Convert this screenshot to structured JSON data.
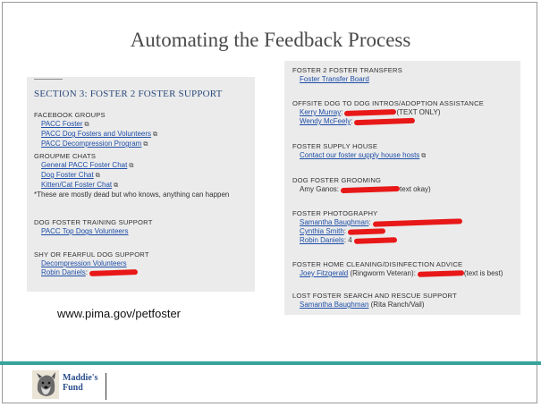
{
  "title": "Automating the Feedback Process",
  "left_panel": {
    "section_heading": "SECTION 3: FOSTER 2 FOSTER SUPPORT",
    "groups": [
      {
        "title": "FACEBOOK GROUPS",
        "items": [
          "PACC Foster",
          "PACC Dog Fosters and Volunteers",
          "PACC Decompression Program"
        ]
      },
      {
        "title": "GROUPME CHATS",
        "items": [
          "General PACC Foster Chat",
          "Dog Foster Chat",
          "Kitten/Cat Foster Chat"
        ],
        "note": "*These are mostly dead but who knows, anything can happen"
      },
      {
        "title": "DOG FOSTER TRAINING SUPPORT",
        "items": [
          "PACC Top Dogs Volunteers"
        ]
      },
      {
        "title": "SHY OR FEARFUL DOG SUPPORT",
        "items": [
          "Decompression Volunteers",
          "Robin Daniels"
        ]
      }
    ]
  },
  "right_panel": {
    "groups": [
      {
        "title": "FOSTER 2 FOSTER TRANSFERS",
        "items": [
          "Foster Transfer Board"
        ]
      },
      {
        "title": "OFFSITE DOG TO DOG INTROS/ADOPTION ASSISTANCE",
        "items": [
          "Kerry Murray",
          "Wendy McFeely"
        ],
        "suffixes": [
          "(TEXT ONLY)",
          ""
        ]
      },
      {
        "title": "FOSTER SUPPLY HOUSE",
        "items": [
          "Contact our foster supply house hosts"
        ]
      },
      {
        "title": "DOG FOSTER GROOMING",
        "items": [
          "Amy Ganos:"
        ],
        "suffixes": [
          "text okay)"
        ]
      },
      {
        "title": "FOSTER PHOTOGRAPHY",
        "items": [
          "Samantha Baughman",
          "Cynthia Smith",
          "Robin Daniels"
        ],
        "partials": [
          "",
          "",
          "4"
        ]
      },
      {
        "title": "FOSTER HOME CLEANING/DISINFECTION ADVICE",
        "items": [
          "Joey Fitzgerald"
        ],
        "suffixes": [
          "(Ringworm Veteran):",
          "(text is best)"
        ]
      },
      {
        "title": "LOST FOSTER SEARCH AND RESCUE SUPPORT",
        "items": [
          "Samantha Baughman"
        ],
        "suffixes": [
          "(Rita Ranch/Vail)"
        ]
      }
    ]
  },
  "url": "www.pima.gov/petfoster",
  "footer": {
    "logo_text_line1": "Maddie's",
    "logo_text_line2": "Fund"
  },
  "colors": {
    "heading": "#2f4b7c",
    "link": "#1f4fa8",
    "redaction": "#e81818",
    "footer_bar": "#37a39b",
    "panel": "#ebebeb"
  },
  "icons": [
    "external-link-icon",
    "maddies-fund-dog-logo"
  ]
}
